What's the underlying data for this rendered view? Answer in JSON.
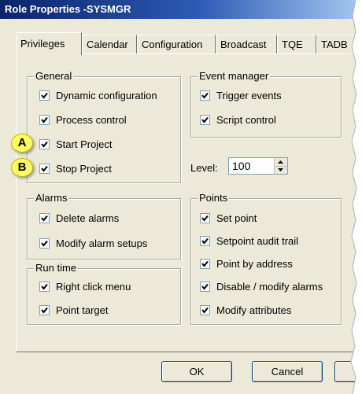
{
  "window": {
    "title": "Role Properties -SYSMGR"
  },
  "tabs": [
    "Privileges",
    "Calendar",
    "Configuration",
    "Broadcast",
    "TQE",
    "TADB"
  ],
  "general": {
    "legend": "General",
    "items": [
      "Dynamic configuration",
      "Process control",
      "Start Project",
      "Stop Project"
    ]
  },
  "event_manager": {
    "legend": "Event manager",
    "items": [
      "Trigger events",
      "Script control"
    ]
  },
  "level": {
    "label": "Level:",
    "value": "100"
  },
  "alarms": {
    "legend": "Alarms",
    "items": [
      "Delete alarms",
      "Modify alarm setups"
    ]
  },
  "run_time": {
    "legend": "Run time",
    "items": [
      "Right click menu",
      "Point target"
    ]
  },
  "points": {
    "legend": "Points",
    "items": [
      "Set point",
      "Setpoint audit trail",
      "Point by address",
      "Disable / modify alarms",
      "Modify attributes"
    ]
  },
  "buttons": {
    "ok": "OK",
    "cancel": "Cancel"
  },
  "callouts": {
    "a": "A",
    "b": "B"
  },
  "colors": {
    "title_bar": "#0a246a",
    "callout": "#ffff66",
    "dialog": "#ece9d8"
  }
}
